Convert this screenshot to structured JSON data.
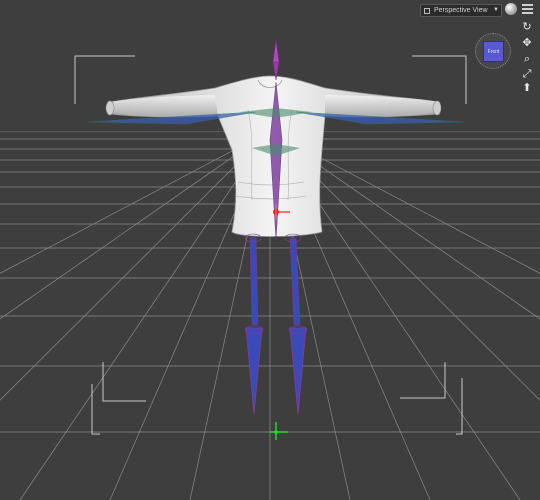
{
  "viewport": {
    "view_label": "Perspective View",
    "nav_cube_label": "Front",
    "colors": {
      "background": "#3e3e3e",
      "grid": "#8a8a8a",
      "figure": "#e6e6e6",
      "bone": "#8e3fa0",
      "bone_blue": "#3a4ab8",
      "axis_red": "#ff2020",
      "axis_green": "#20e020"
    }
  },
  "icons": {
    "camera": "camera-icon",
    "dropdown": "chevron-down-icon",
    "shading": "sphere-icon",
    "menu": "menu-icon",
    "orbit": "orbit-icon",
    "pan": "pan-icon",
    "zoom": "zoom-icon",
    "frame": "frame-icon",
    "reset": "reset-view-icon"
  }
}
